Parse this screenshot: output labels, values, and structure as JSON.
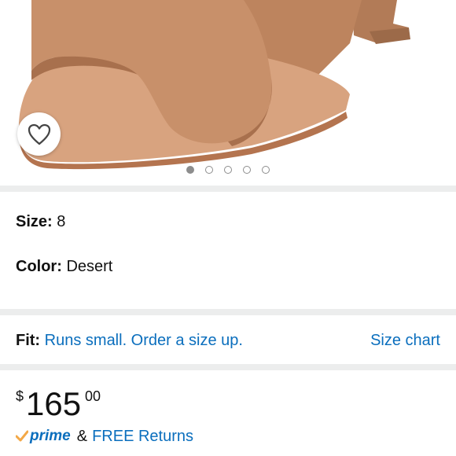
{
  "product": {
    "image_alt": "Desert suede slide sandal",
    "carousel": {
      "count": 5,
      "active_index": 0
    },
    "wishlist_icon": "heart-outline-icon"
  },
  "details": {
    "size_label": "Size:",
    "size_value": "8",
    "color_label": "Color:",
    "color_value": "Desert"
  },
  "fit": {
    "label": "Fit:",
    "text": "Runs small. Order a size up.",
    "size_chart": "Size chart"
  },
  "price": {
    "currency": "$",
    "whole": "165",
    "fraction": "00"
  },
  "shipping": {
    "prime_text": "prime",
    "amp": "&",
    "returns": "FREE Returns"
  },
  "colors": {
    "link": "#0a6ebd",
    "prime_check": "#f3a847",
    "divider": "#eceded",
    "suede": "#c8906a"
  }
}
